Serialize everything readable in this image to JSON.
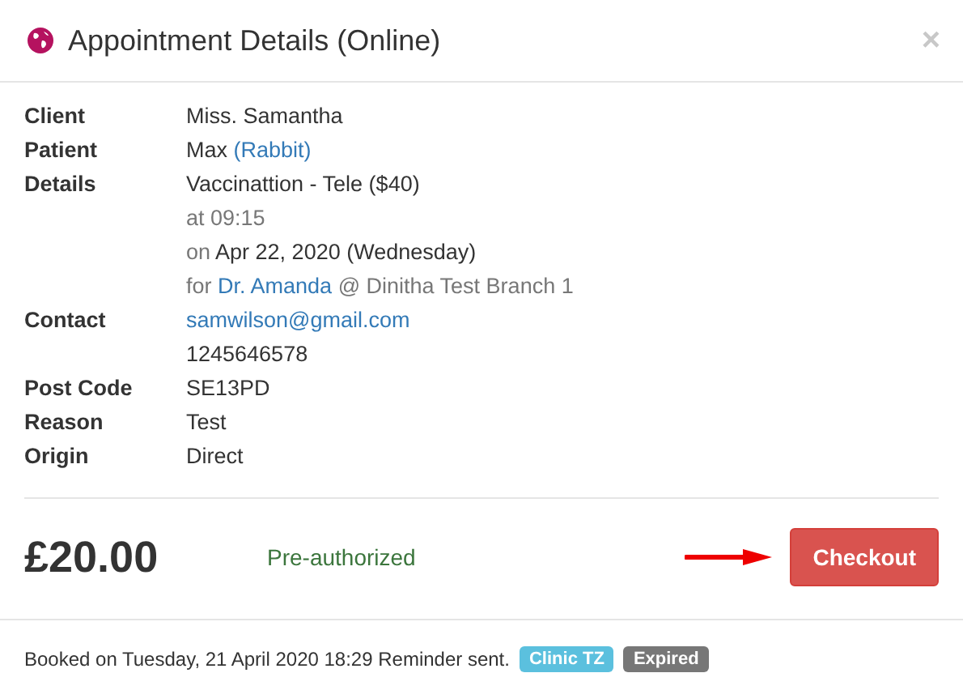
{
  "dialog": {
    "title": "Appointment Details (Online)",
    "close": "×"
  },
  "details": [
    {
      "label": "Client",
      "lines": [
        [
          {
            "kind": "plain",
            "text": "Miss. Samantha"
          }
        ]
      ]
    },
    {
      "label": "Patient",
      "lines": [
        [
          {
            "kind": "plain",
            "text": "Max "
          },
          {
            "kind": "link",
            "text": "(Rabbit)"
          }
        ]
      ]
    },
    {
      "label": "Details",
      "lines": [
        [
          {
            "kind": "plain",
            "text": "Vaccinattion - Tele ($40)"
          }
        ],
        [
          {
            "kind": "muted",
            "text": "at 09:15"
          }
        ],
        [
          {
            "kind": "muted",
            "text": "on "
          },
          {
            "kind": "plain",
            "text": "Apr 22, 2020 (Wednesday)"
          }
        ],
        [
          {
            "kind": "muted",
            "text": "for "
          },
          {
            "kind": "link",
            "text": "Dr. Amanda"
          },
          {
            "kind": "muted",
            "text": " @ Dinitha Test Branch 1"
          }
        ]
      ]
    },
    {
      "label": "Contact",
      "lines": [
        [
          {
            "kind": "link",
            "text": "samwilson@gmail.com"
          }
        ],
        [
          {
            "kind": "plain",
            "text": "1245646578"
          }
        ]
      ]
    },
    {
      "label": "Post Code",
      "lines": [
        [
          {
            "kind": "plain",
            "text": "SE13PD"
          }
        ]
      ]
    },
    {
      "label": "Reason",
      "lines": [
        [
          {
            "kind": "plain",
            "text": "Test"
          }
        ]
      ]
    },
    {
      "label": "Origin",
      "lines": [
        [
          {
            "kind": "plain",
            "text": "Direct"
          }
        ]
      ]
    }
  ],
  "payment": {
    "amount": "£20.00",
    "status": "Pre-authorized",
    "button": "Checkout"
  },
  "footer": {
    "text": "Booked on Tuesday, 21 April 2020 18:29 Reminder sent.",
    "badges": [
      {
        "label": "Clinic TZ",
        "color": "#5bc0de"
      },
      {
        "label": "Expired",
        "color": "#777777"
      }
    ]
  }
}
